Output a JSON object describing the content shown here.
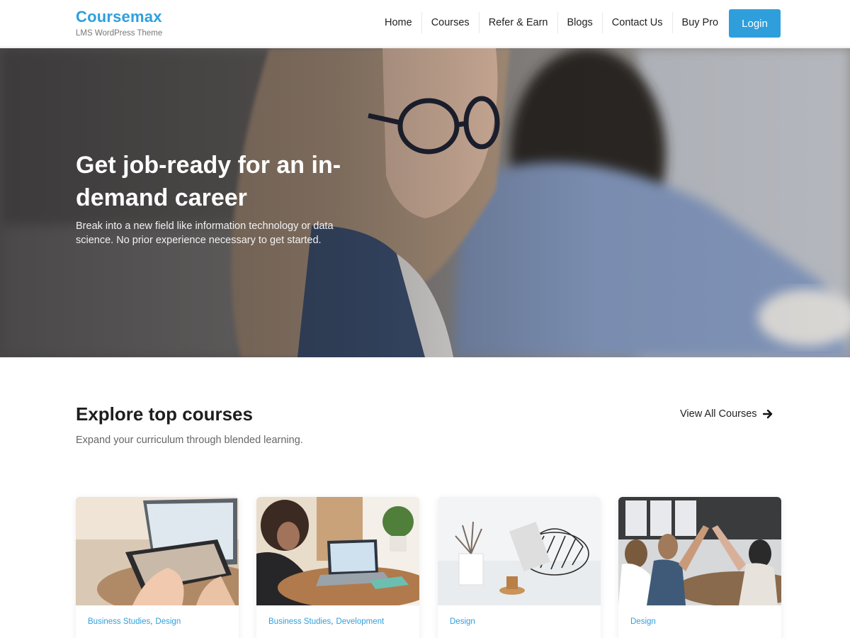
{
  "brand": {
    "title": "Coursemax",
    "tagline": "LMS WordPress Theme"
  },
  "nav": {
    "items": [
      "Home",
      "Courses",
      "Refer & Earn",
      "Blogs",
      "Contact Us",
      "Buy Pro"
    ]
  },
  "login_label": "Login",
  "hero": {
    "title": "Get job-ready for an in-demand career",
    "subtitle": "Break into a new field like information technology or data science. No prior experience necessary to get started."
  },
  "courses": {
    "title": "Explore top courses",
    "subtitle": "Expand your curriculum through blended learning.",
    "view_all": "View All Courses",
    "cards": [
      {
        "categories": [
          "Business Studies",
          "Design"
        ]
      },
      {
        "categories": [
          "Business Studies",
          "Development"
        ]
      },
      {
        "categories": [
          "Design"
        ]
      },
      {
        "categories": [
          "Design"
        ]
      }
    ]
  },
  "colors": {
    "accent": "#2f9fdc"
  }
}
